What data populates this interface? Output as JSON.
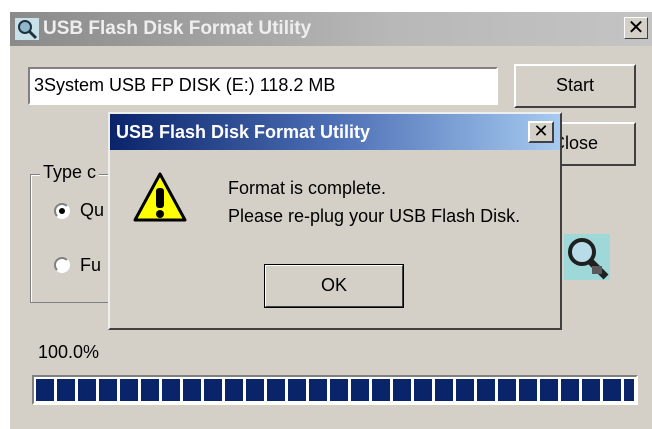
{
  "main_window": {
    "title": "USB Flash Disk Format Utility",
    "close_glyph": "✕",
    "device_field_value": "3System USB FP DISK (E:)  118.2 MB",
    "start_label": "Start",
    "close_label": "Close",
    "close_label_visible": "ose",
    "group_label": "Type c",
    "radio_quick_label": "Qu",
    "radio_full_label": "Fu",
    "selected_mode": "quick",
    "progress_text": "100.0%",
    "progress_fraction": 1.0,
    "icons": [
      "usb-search-icon",
      "magnifier-icon",
      "warning-icon"
    ]
  },
  "dialog": {
    "title": "USB Flash Disk Format Utility",
    "close_glyph": "✕",
    "message_line1": "Format is complete.",
    "message_line2": "Please re-plug your USB Flash Disk.",
    "ok_label": "OK"
  },
  "colors": {
    "dialog_title_start": "#0a246a",
    "dialog_title_end": "#a6caf0",
    "progress_block": "#0a246a",
    "window_bg": "#d4d0c8"
  }
}
